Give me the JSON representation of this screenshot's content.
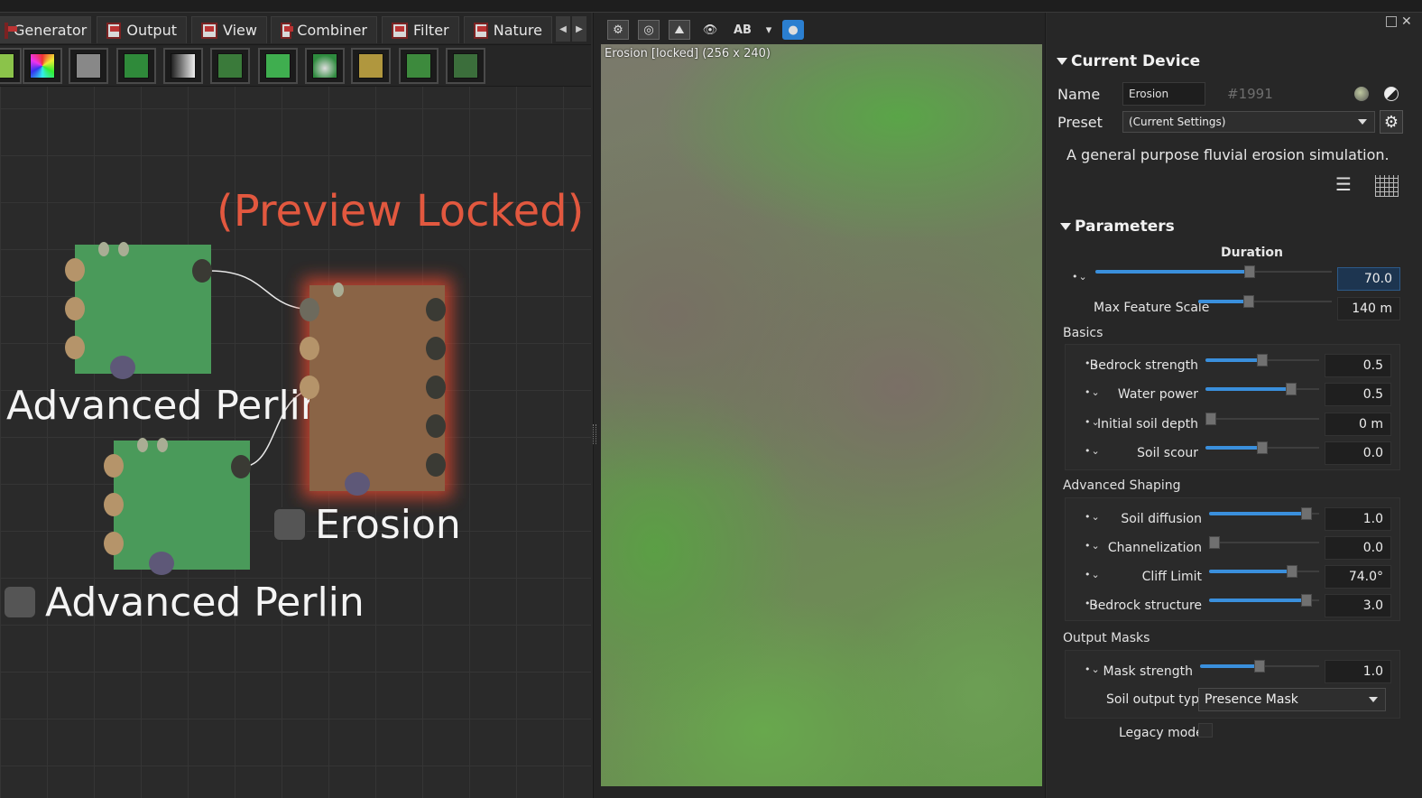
{
  "tabs": [
    {
      "label": "Generator",
      "icon": "generator-icon"
    },
    {
      "label": "Output",
      "icon": "output-icon"
    },
    {
      "label": "View",
      "icon": "view-icon"
    },
    {
      "label": "Combiner",
      "icon": "combiner-icon"
    },
    {
      "label": "Filter",
      "icon": "filter-icon"
    },
    {
      "label": "Nature",
      "icon": "nature-icon"
    }
  ],
  "graph": {
    "preview_locked": "(Preview Locked)",
    "node_top_label": "Advanced Perlin",
    "node_bottom_label": "Advanced Perlin",
    "erosion_label": "Erosion"
  },
  "viewport": {
    "label": "Erosion [locked] (256 x 240)",
    "ab_label": "AB"
  },
  "device": {
    "section": "Current Device",
    "name_label": "Name",
    "name_value": "Erosion",
    "id": "#1991",
    "preset_label": "Preset",
    "preset_value": "(Current Settings)",
    "description": "A general purpose fluvial erosion simulation."
  },
  "parameters": {
    "section": "Parameters",
    "duration": {
      "label": "Duration",
      "value": "70.0",
      "fraction": 0.66
    },
    "max_feature": {
      "label": "Max Feature Scale",
      "value": "140 m",
      "fraction": 0.37
    },
    "groups": [
      {
        "title": "Basics",
        "items": [
          {
            "label": "Bedrock strength",
            "value": "0.5",
            "fraction": 0.5
          },
          {
            "label": "Water power",
            "value": "0.5",
            "fraction": 0.78
          },
          {
            "label": "Initial soil depth",
            "value": "0 m",
            "fraction": 0.0
          },
          {
            "label": "Soil scour",
            "value": "0.0",
            "fraction": 0.5
          }
        ]
      },
      {
        "title": "Advanced Shaping",
        "items": [
          {
            "label": "Soil diffusion",
            "value": "1.0",
            "fraction": 0.93
          },
          {
            "label": "Channelization",
            "value": "0.0",
            "fraction": 0.0
          },
          {
            "label": "Cliff Limit",
            "value": "74.0°",
            "fraction": 0.78
          },
          {
            "label": "Bedrock structure",
            "value": "3.0",
            "fraction": 0.93
          }
        ]
      },
      {
        "title": "Output Masks",
        "items": [
          {
            "label": "Mask strength",
            "value": "1.0",
            "fraction": 0.5
          }
        ]
      }
    ],
    "soil_output": {
      "label": "Soil output type",
      "value": "Presence Mask"
    },
    "legacy": {
      "label": "Legacy mode",
      "checked": false
    }
  }
}
